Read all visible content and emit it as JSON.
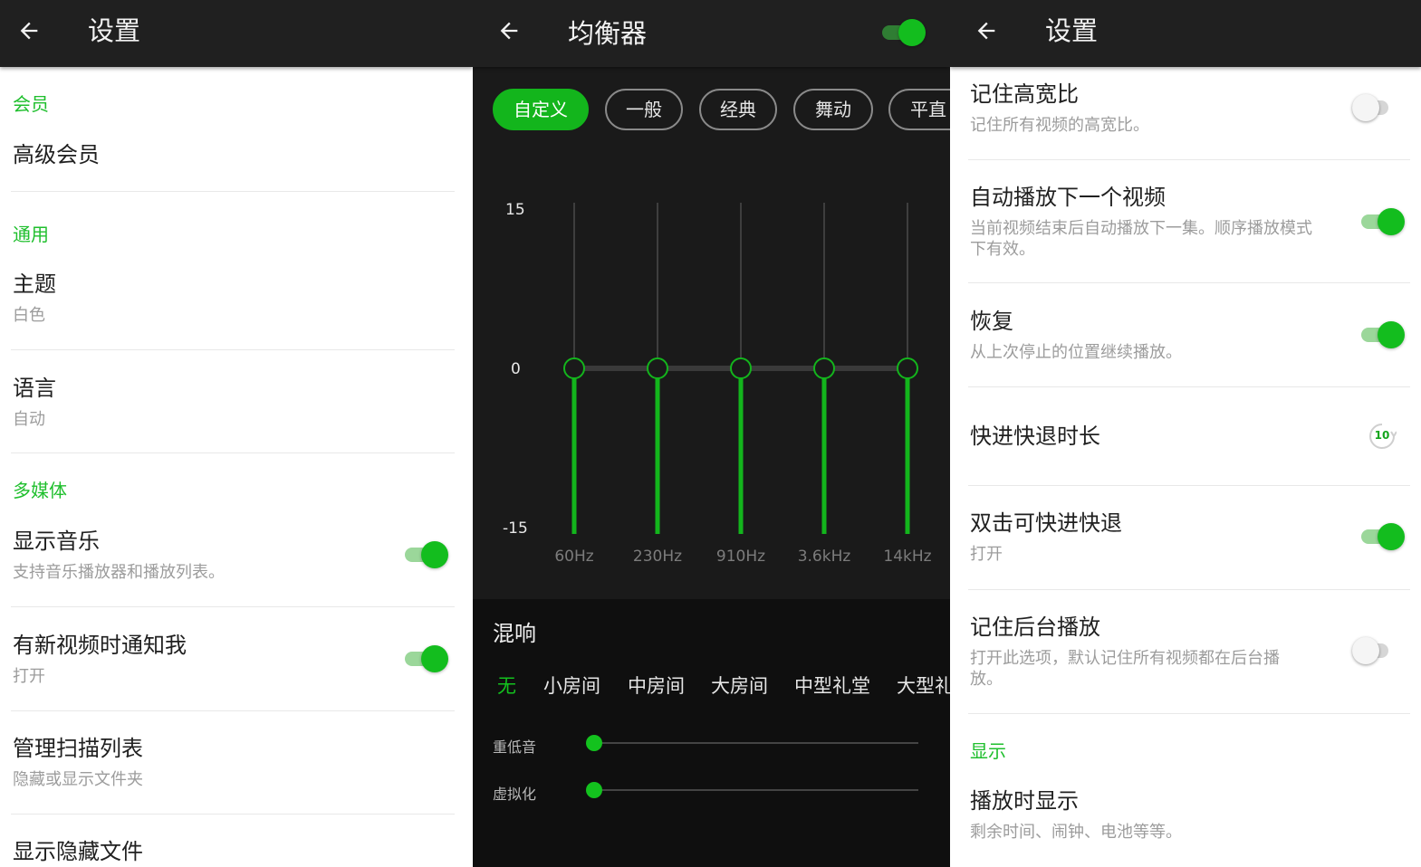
{
  "left_panel": {
    "title": "设置",
    "sections": {
      "member": "会员",
      "general": "通用",
      "media": "多媒体"
    },
    "items": {
      "premium": {
        "title": "高级会员"
      },
      "theme": {
        "title": "主题",
        "sub": "白色"
      },
      "language": {
        "title": "语言",
        "sub": "自动"
      },
      "show_music": {
        "title": "显示音乐",
        "sub": "支持音乐播放器和播放列表。",
        "on": true
      },
      "notify": {
        "title": "有新视频时通知我",
        "sub": "打开",
        "on": true
      },
      "scan_list": {
        "title": "管理扫描列表",
        "sub": "隐藏或显示文件夹"
      },
      "hidden_files": {
        "title": "显示隐藏文件"
      }
    }
  },
  "equalizer": {
    "title": "均衡器",
    "enabled": true,
    "presets": [
      "自定义",
      "一般",
      "经典",
      "舞动",
      "平直"
    ],
    "active_preset": "自定义",
    "y_labels": [
      "15",
      "0",
      "-15"
    ],
    "bands": [
      {
        "freq": "60Hz",
        "value": 0
      },
      {
        "freq": "230Hz",
        "value": 0
      },
      {
        "freq": "910Hz",
        "value": 0
      },
      {
        "freq": "3.6kHz",
        "value": 0
      },
      {
        "freq": "14kHz",
        "value": 0
      }
    ],
    "reverb_title": "混响",
    "reverb_options": [
      "无",
      "小房间",
      "中房间",
      "大房间",
      "中型礼堂",
      "大型礼"
    ],
    "active_reverb": "无",
    "bass_label": "重低音",
    "bass_value": 0,
    "virtualizer_label": "虚拟化",
    "virtualizer_value": 0
  },
  "right_panel": {
    "title": "设置",
    "items": {
      "aspect": {
        "title": "记住高宽比",
        "sub": "记住所有视频的高宽比。",
        "on": false
      },
      "autoplay": {
        "title": "自动播放下一个视频",
        "sub": "当前视频结束后自动播放下一集。顺序播放模式下有效。",
        "on": true
      },
      "resume": {
        "title": "恢复",
        "sub": "从上次停止的位置继续播放。",
        "on": true
      },
      "seek": {
        "title": "快进快退时长",
        "badge": "10"
      },
      "double_tap": {
        "title": "双击可快进快退",
        "sub": "打开",
        "on": true
      },
      "background": {
        "title": "记住后台播放",
        "sub": "打开此选项，默认记住所有视频都在后台播放。",
        "on": false
      }
    },
    "section_display": "显示",
    "display_item": {
      "title": "播放时显示",
      "sub": "剩余时间、闹钟、电池等等。"
    }
  },
  "colors": {
    "accent": "#13bd1e",
    "topbar": "#202020",
    "eq_bg": "#1a1a1a"
  }
}
